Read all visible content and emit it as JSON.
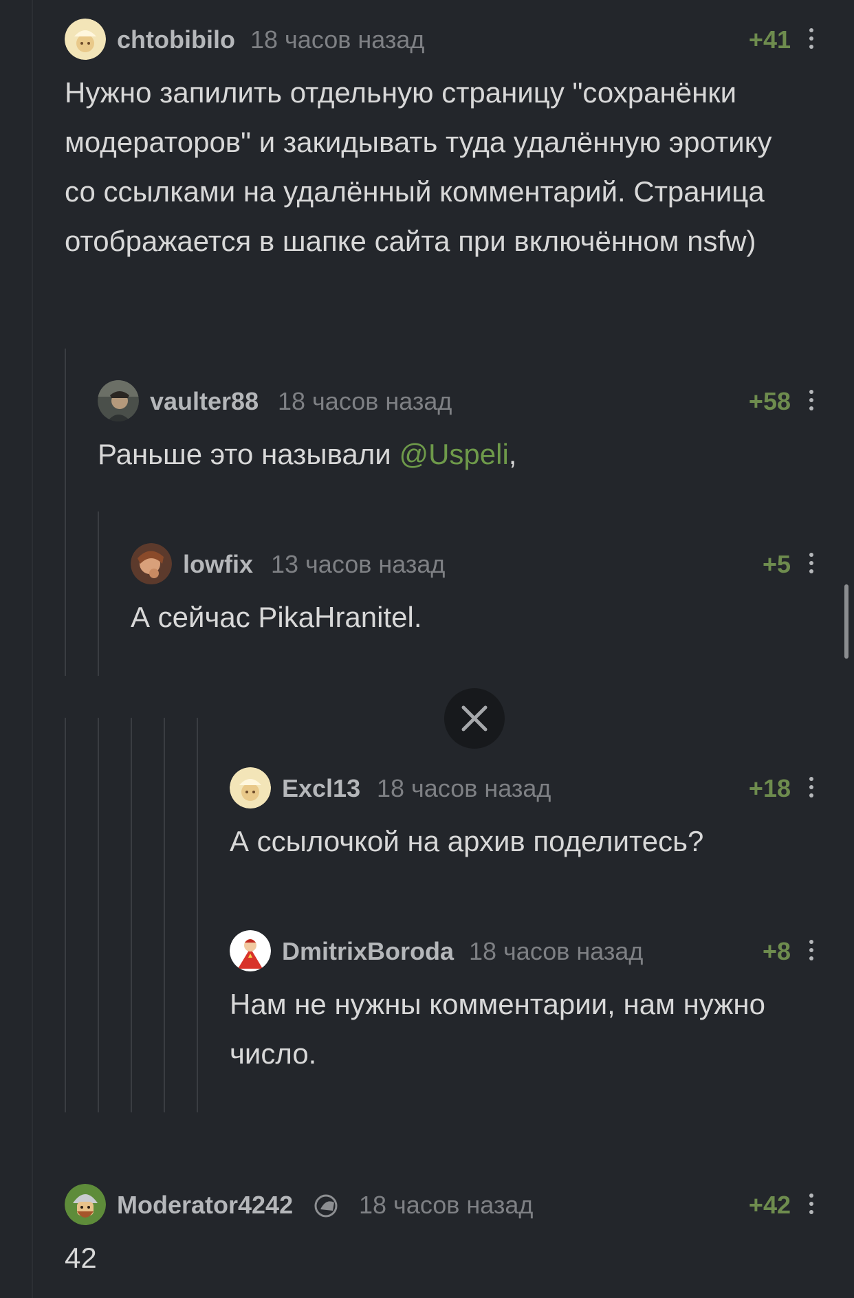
{
  "comments": [
    {
      "author": "chtobibilo",
      "time": "18 часов назад",
      "rating": "+41",
      "text": "Нужно запилить отдельную страницу \"сохранёнки модераторов\" и закидывать туда удалённую эротику со ссылками на удалённый комментарий. Страница отображается в шапке сайта при включённом nsfw)"
    },
    {
      "author": "vaulter88",
      "time": "18 часов назад",
      "rating": "+58",
      "text_before": "Раньше это называли ",
      "mention": "@Uspeli",
      "text_after": ","
    },
    {
      "author": "lowfix",
      "time": "13 часов назад",
      "rating": "+5",
      "text": "А сейчас PikaHranitel."
    },
    {
      "author": "Excl13",
      "time": "18 часов назад",
      "rating": "+18",
      "text": "А ссылочкой на архив поделитесь?"
    },
    {
      "author": "DmitrixBoroda",
      "time": "18 часов назад",
      "rating": "+8",
      "text": "Нам не нужны комментарии, нам нужно число."
    },
    {
      "author": "Moderator4242",
      "time": "18 часов назад",
      "rating": "+42",
      "text": "42"
    }
  ],
  "icons": {
    "more": "more-vertical-icon",
    "close": "close-icon",
    "moderator": "moderator-badge-icon"
  },
  "colors": {
    "background": "#23262b",
    "rating": "#6e8c4e",
    "mention": "#6e9a4a",
    "author": "#b5b7ba",
    "time": "#7e8084"
  }
}
